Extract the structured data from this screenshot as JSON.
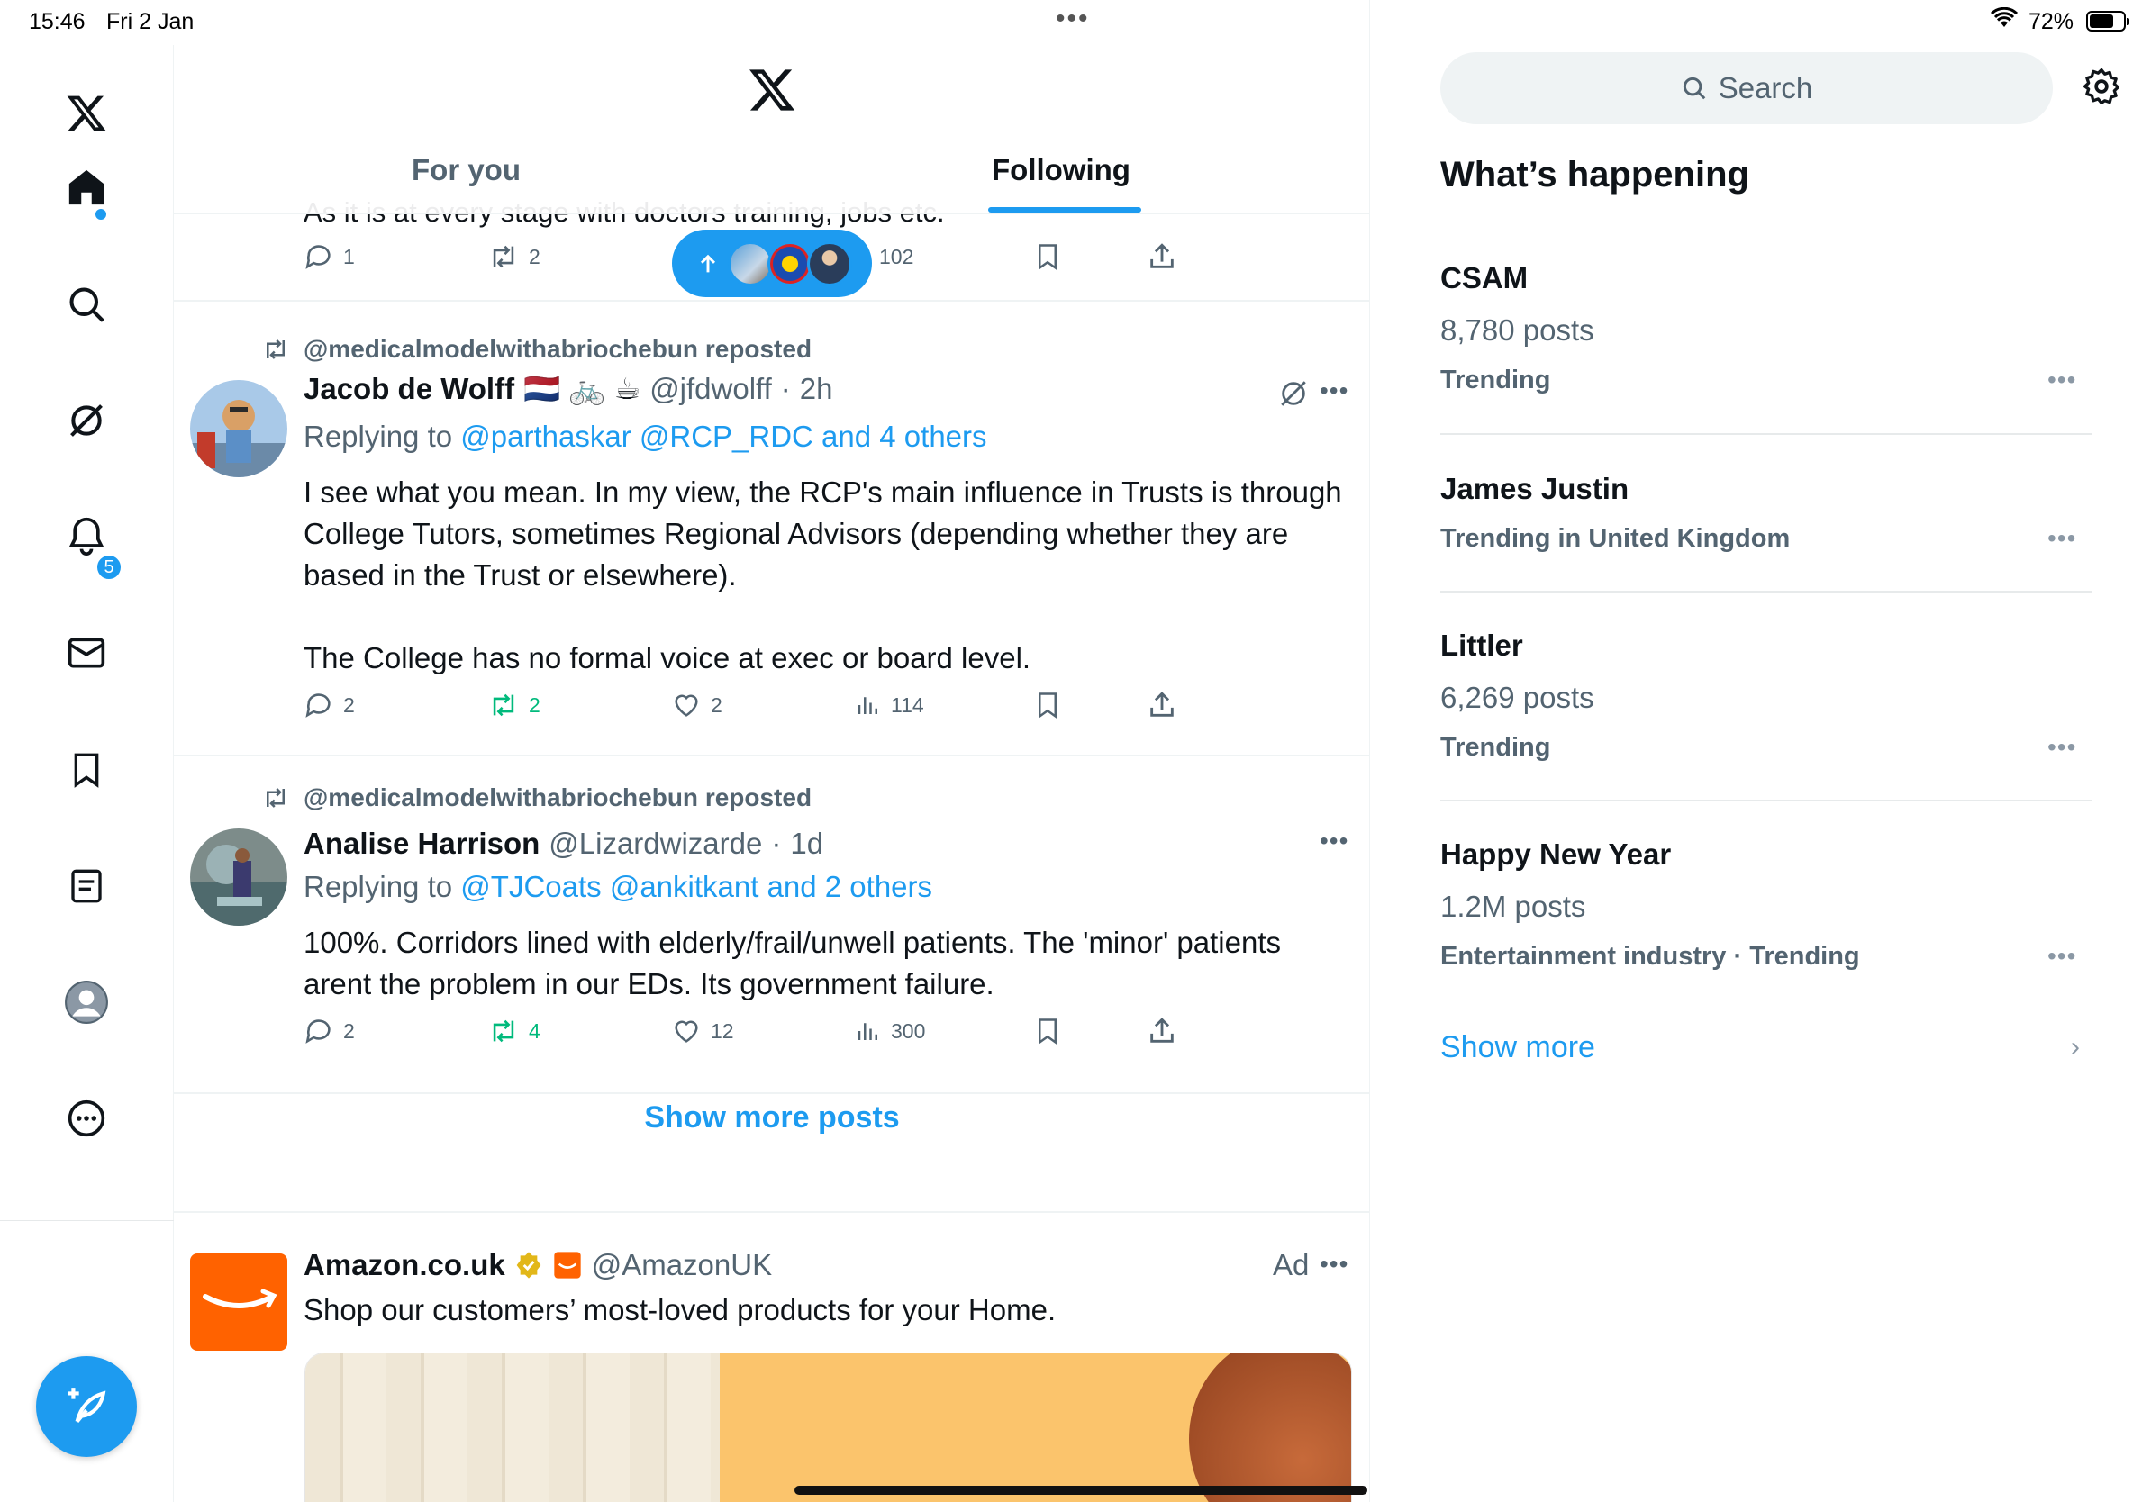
{
  "status": {
    "time": "15:46",
    "date": "Fri 2 Jan",
    "battery": "72%",
    "battery_level": 0.72
  },
  "nav": {
    "notifications_badge": "5"
  },
  "tabs": [
    {
      "label": "For you"
    },
    {
      "label": "Following"
    }
  ],
  "posts": [
    {
      "cut_text": "As it is at every stage with doctors training, jobs etc.",
      "replies": "1",
      "reposts": "2",
      "views": "102"
    },
    {
      "repost_by": "@medicalmodelwithabriochebun reposted",
      "name": "Jacob de Wolff",
      "emojis": "🇳🇱 🚲 ☕",
      "handle": "@jfdwolff",
      "time": "2h",
      "reply_prefix": "Replying to",
      "reply_links": "@parthaskar @RCP_RDC and 4 others",
      "text_p1": "I see what you mean. In my view, the RCP's main influence in Trusts is through College Tutors, sometimes Regional Advisors (depending whether they are based in the Trust or elsewhere).",
      "text_p2": "The College has no formal voice at exec or board level.",
      "replies": "2",
      "reposts": "2",
      "likes": "2",
      "views": "114"
    },
    {
      "repost_by": "@medicalmodelwithabriochebun reposted",
      "name": "Analise Harrison",
      "handle": "@Lizardwizarde",
      "time": "1d",
      "reply_prefix": "Replying to",
      "reply_links": "@TJCoats @ankitkant and 2 others",
      "text": "100%. Corridors lined with elderly/frail/unwell patients. The 'minor' patients arent the problem in our EDs. Its government failure.",
      "replies": "2",
      "reposts": "4",
      "likes": "12",
      "views": "300"
    }
  ],
  "show_more_posts": "Show more posts",
  "ad": {
    "name": "Amazon.co.uk",
    "handle": "@AmazonUK",
    "label": "Ad",
    "text": "Shop our customers’ most-loved products for your Home."
  },
  "sidebar": {
    "search_placeholder": "Search",
    "title": "What’s happening",
    "trends": [
      {
        "name": "CSAM",
        "count": "8,780 posts",
        "meta": "Trending"
      },
      {
        "name": "James Justin",
        "meta": "Trending in United Kingdom"
      },
      {
        "name": "Littler",
        "count": "6,269 posts",
        "meta": "Trending"
      },
      {
        "name": "Happy New Year",
        "count": "1.2M posts",
        "meta": "Entertainment industry · Trending"
      }
    ],
    "show_more": "Show more"
  },
  "colors": {
    "accent": "#1d9bf0",
    "repost_green": "#00ba7c",
    "muted": "#536471",
    "amazon": "#ff6200"
  }
}
